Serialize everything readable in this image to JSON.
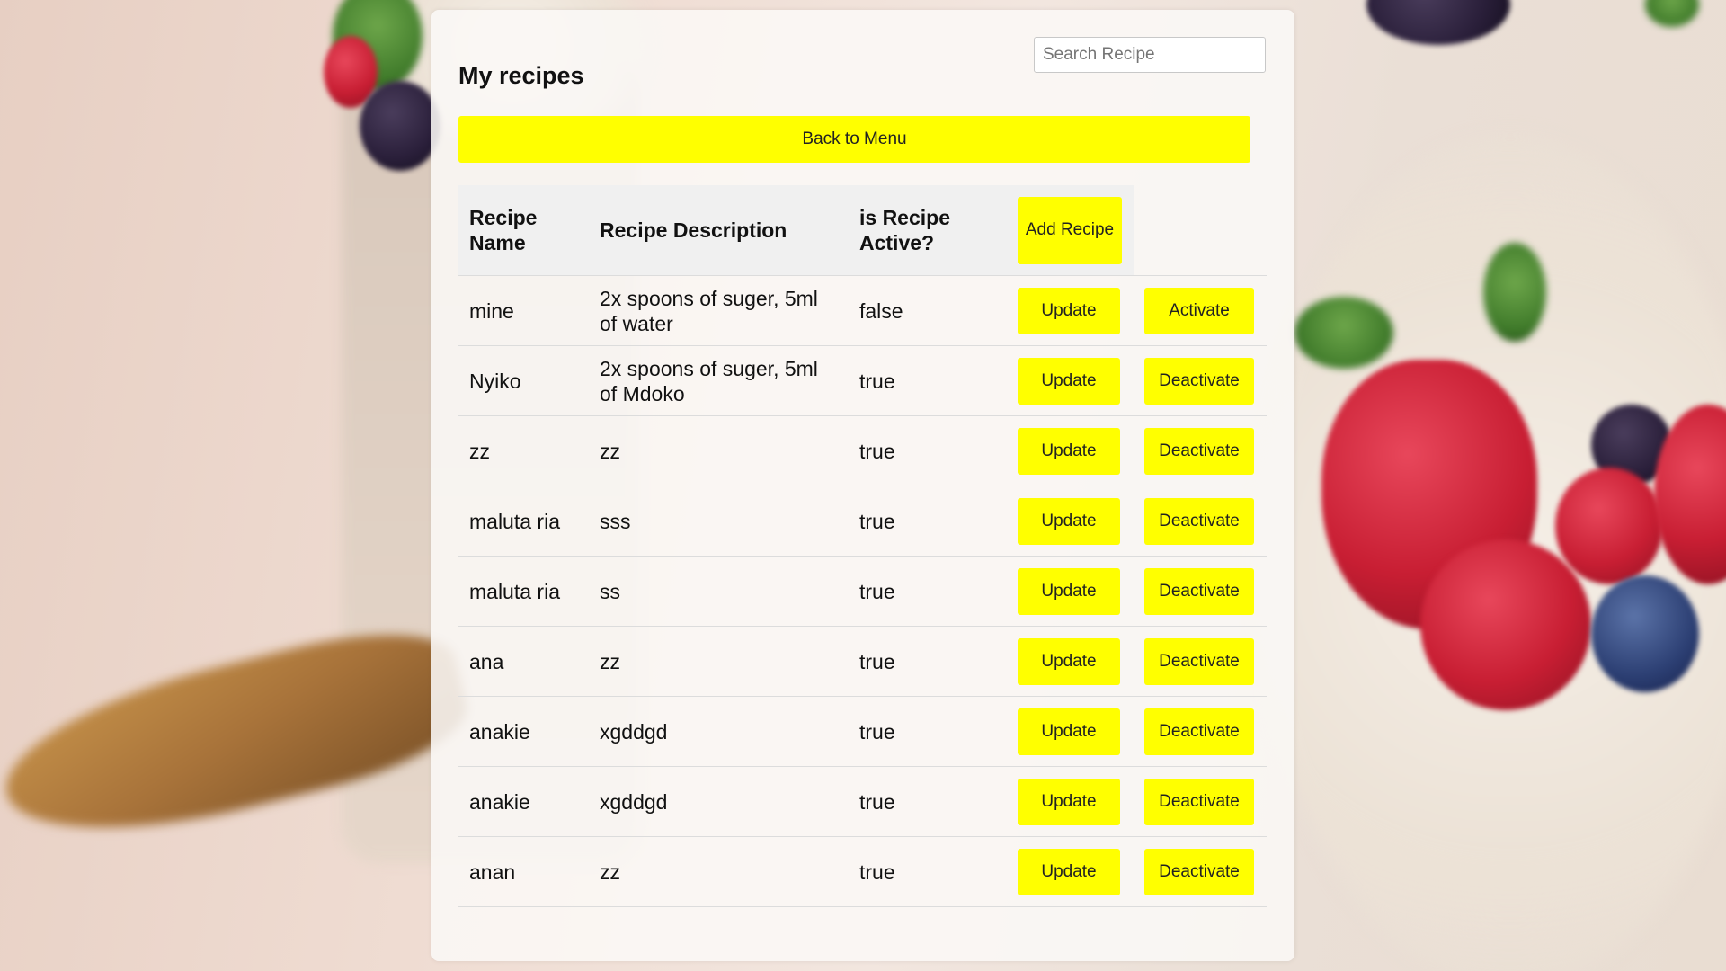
{
  "page": {
    "title": "My recipes",
    "search_placeholder": "Search Recipe",
    "back_label": "Back to Menu"
  },
  "table": {
    "headers": {
      "name": "Recipe Name",
      "description": "Recipe Description",
      "active": "is Recipe Active?",
      "add_label": "Add Recipe"
    },
    "update_label": "Update",
    "rows": [
      {
        "name": "mine",
        "description": "2x spoons of suger, 5ml of water",
        "active": "false",
        "toggle_label": "Activate"
      },
      {
        "name": "Nyiko",
        "description": "2x spoons of suger, 5ml of Mdoko",
        "active": "true",
        "toggle_label": "Deactivate"
      },
      {
        "name": "zz",
        "description": "zz",
        "active": "true",
        "toggle_label": "Deactivate"
      },
      {
        "name": "maluta ria",
        "description": "sss",
        "active": "true",
        "toggle_label": "Deactivate"
      },
      {
        "name": "maluta ria",
        "description": "ss",
        "active": "true",
        "toggle_label": "Deactivate"
      },
      {
        "name": "ana",
        "description": "zz",
        "active": "true",
        "toggle_label": "Deactivate"
      },
      {
        "name": "anakie",
        "description": "xgddgd",
        "active": "true",
        "toggle_label": "Deactivate"
      },
      {
        "name": "anakie",
        "description": "xgddgd",
        "active": "true",
        "toggle_label": "Deactivate"
      },
      {
        "name": "anan",
        "description": "zz",
        "active": "true",
        "toggle_label": "Deactivate"
      }
    ]
  },
  "colors": {
    "button_yellow": "#ffff00",
    "panel_background": "#faf8f6",
    "header_background": "#f0f0f0"
  }
}
